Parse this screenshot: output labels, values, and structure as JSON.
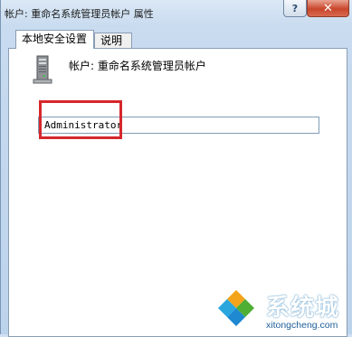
{
  "window": {
    "title": "帐户: 重命名系统管理员帐户 属性",
    "help_glyph": "?",
    "close_glyph": "✕"
  },
  "tabs": [
    {
      "label": "本地安全设置",
      "active": true
    },
    {
      "label": "说明",
      "active": false
    }
  ],
  "policy": {
    "label": "帐户: 重命名系统管理员帐户",
    "icon": "server-policy-icon"
  },
  "field": {
    "value": "Administrator",
    "highlight_color": "#d6272b"
  },
  "watermark": {
    "name": "系统城",
    "url": "xitongcheng.com"
  }
}
